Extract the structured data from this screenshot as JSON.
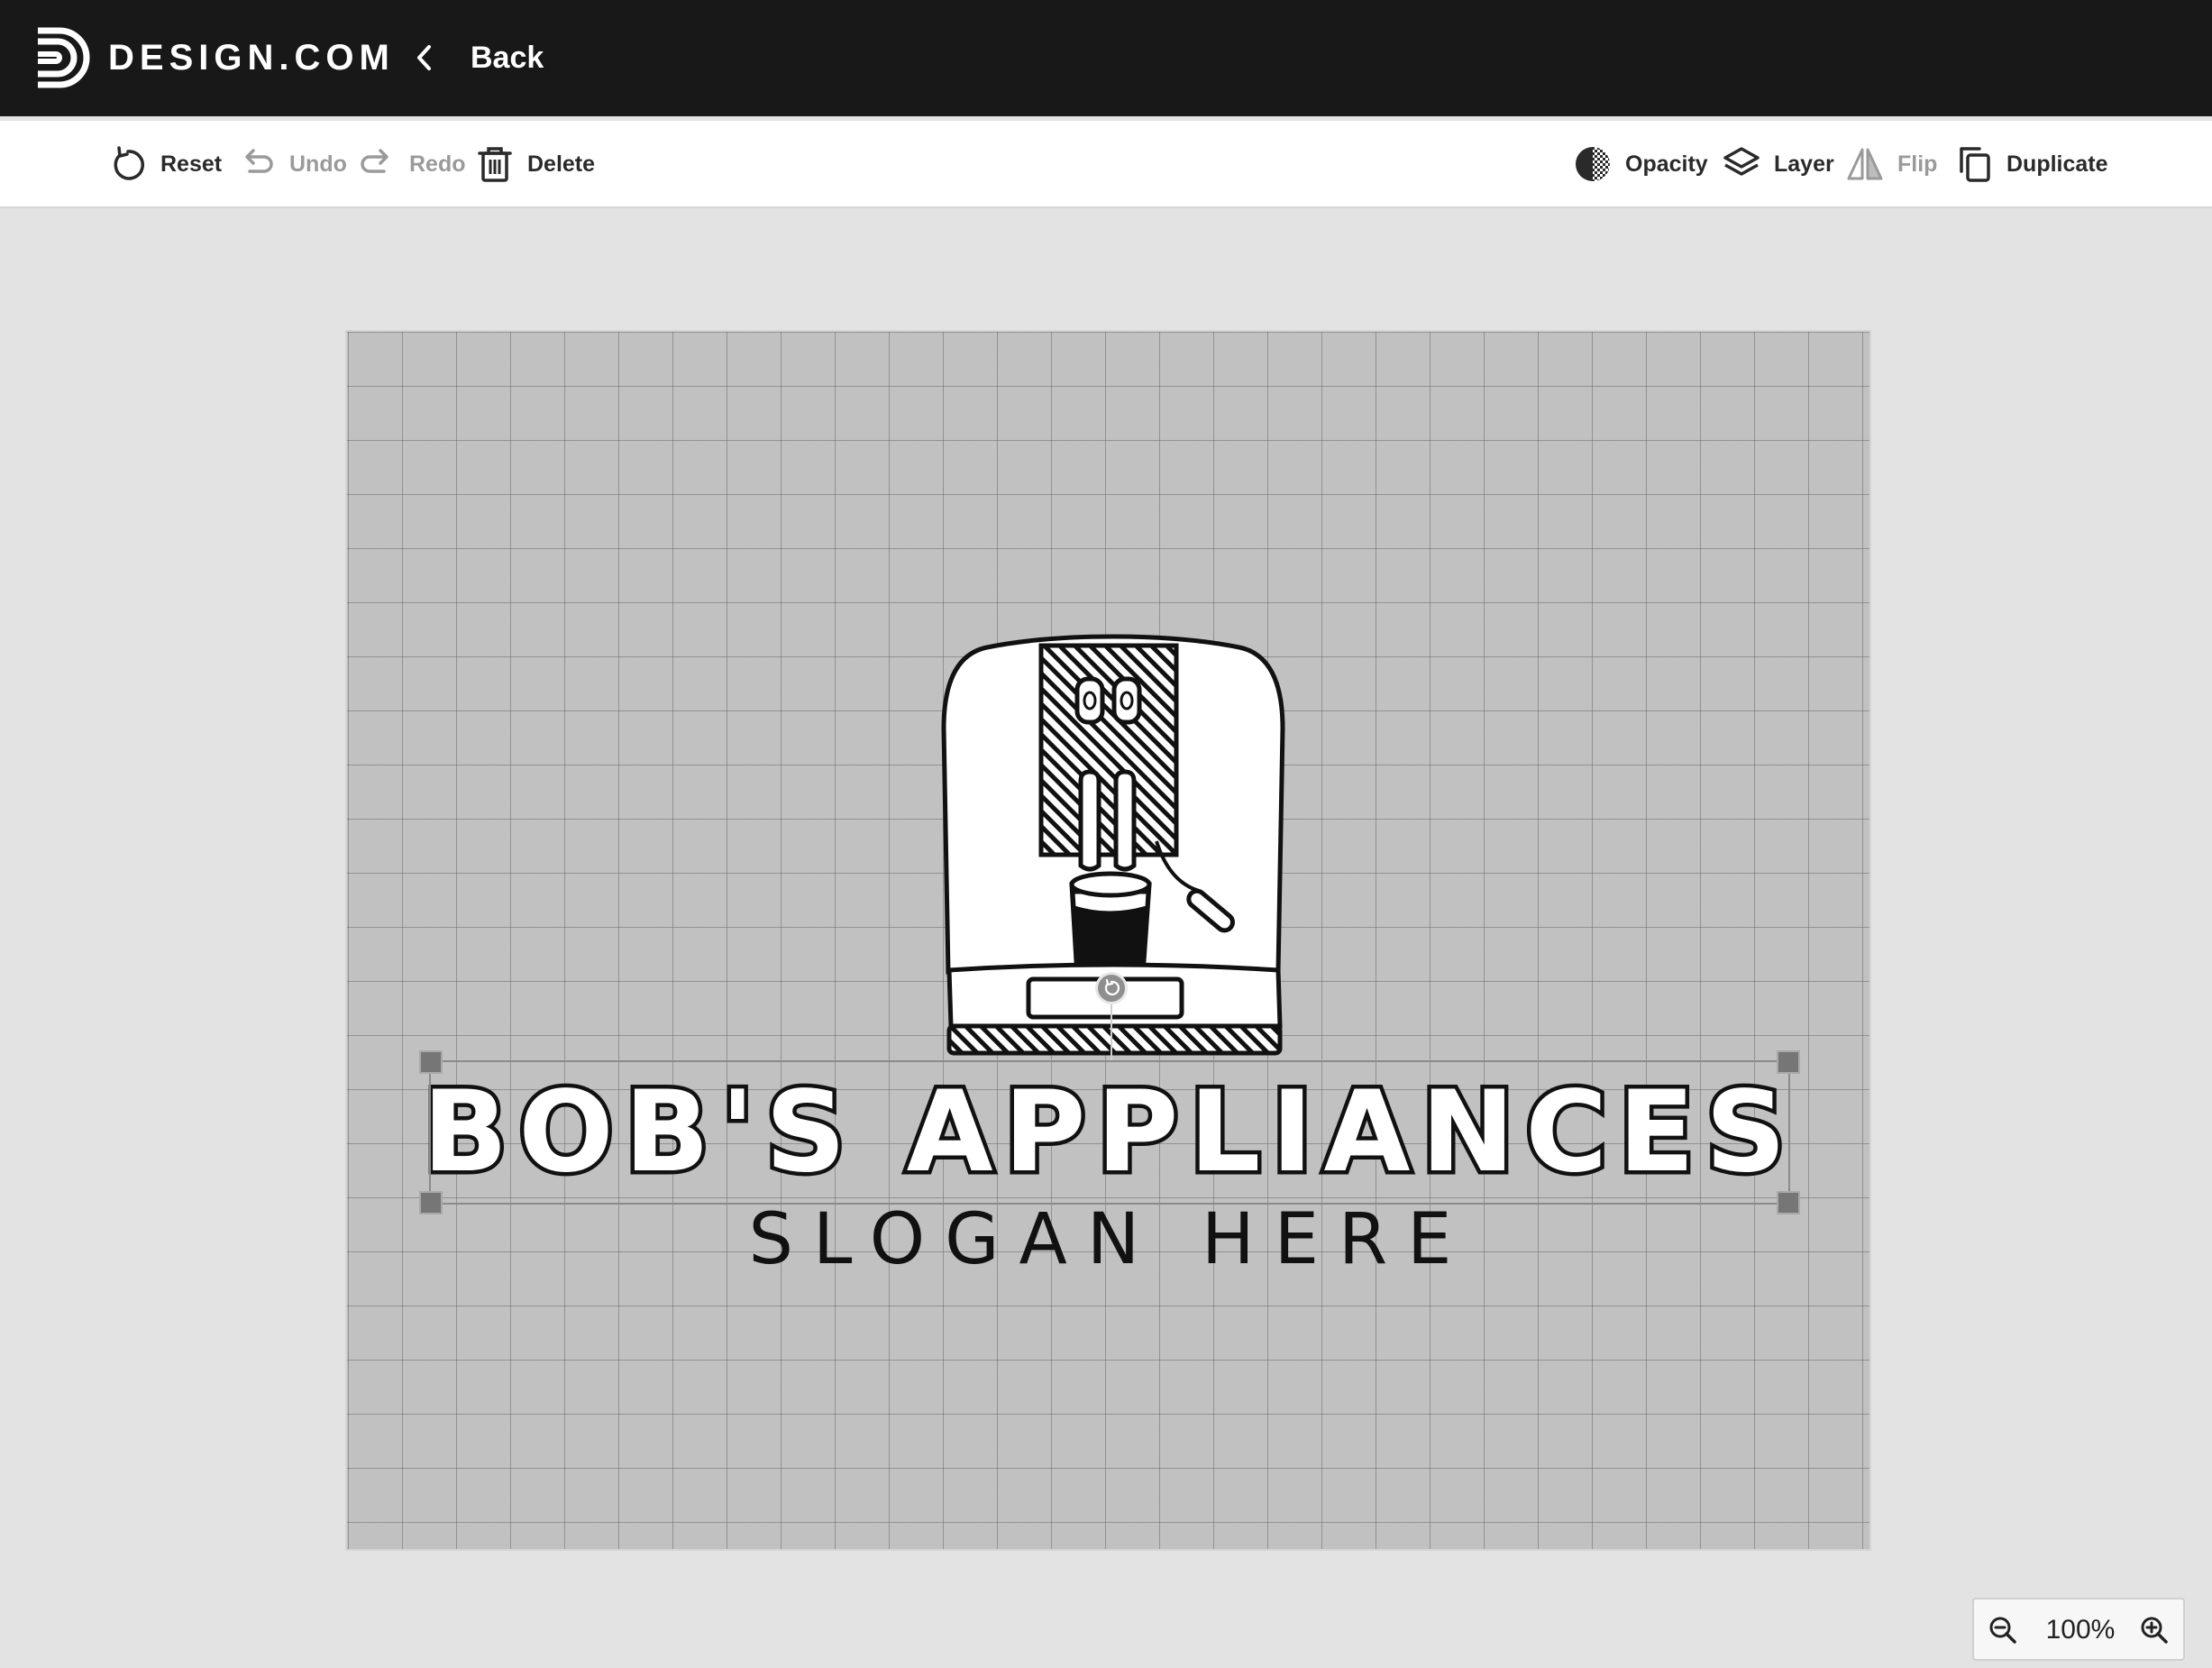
{
  "topbar": {
    "brand": "DESIGN.COM",
    "back_label": "Back"
  },
  "toolbar": {
    "reset": "Reset",
    "undo": "Undo",
    "redo": "Redo",
    "delete": "Delete",
    "opacity": "Opacity",
    "layer": "Layer",
    "flip": "Flip",
    "duplicate": "Duplicate",
    "disabled": [
      "undo",
      "redo",
      "flip"
    ]
  },
  "canvas": {
    "business_name": "BOB'S APPLIANCES",
    "slogan": "SLOGAN HERE",
    "background_color": "#c1c1c1",
    "grid": true,
    "selected_element": "business_name"
  },
  "zoom": {
    "level": "100%"
  },
  "icons": {
    "brand": "design-com-logo-icon",
    "back": "chevron-left-icon",
    "reset": "reset-icon",
    "undo": "undo-icon",
    "redo": "redo-icon",
    "delete": "trash-icon",
    "opacity": "opacity-icon",
    "layer": "layers-icon",
    "flip": "flip-icon",
    "duplicate": "duplicate-icon",
    "zoom_out": "zoom-out-icon",
    "zoom_in": "zoom-in-icon",
    "rotate": "rotate-icon",
    "logo_graphic": "coffee-machine-icon"
  },
  "colors": {
    "topbar": "#181818",
    "workspace": "#e3e3e3",
    "text_dark": "#2a2a2a",
    "text_disabled": "#9a9a9a"
  }
}
